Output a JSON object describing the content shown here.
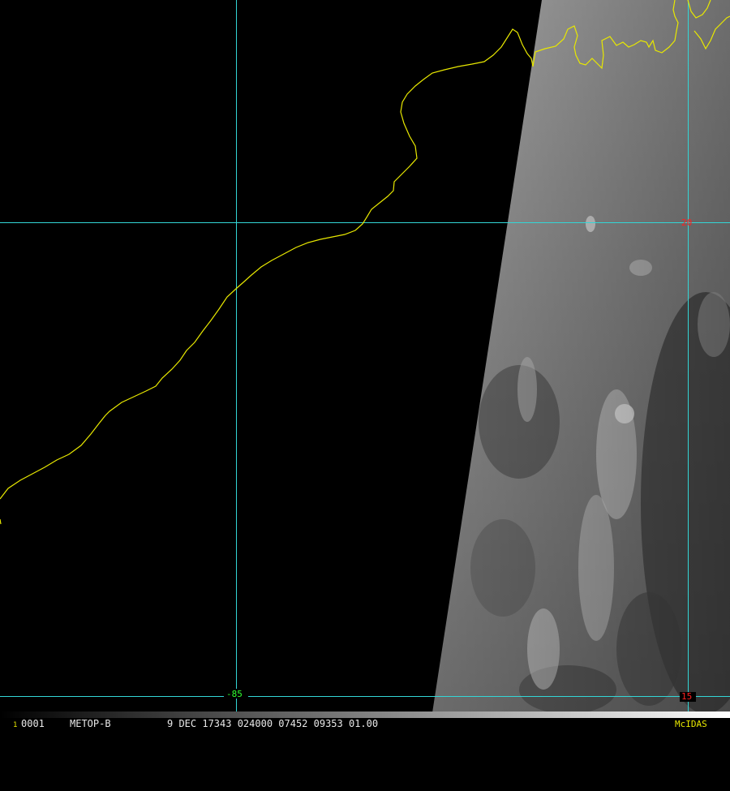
{
  "window": {
    "frame_number": "1",
    "frame_id": "0001",
    "satellite": "METOP-B",
    "datetime_line": "9 DEC 17343 024000 07452 09353 01.00",
    "software": "McIDAS"
  },
  "grid": {
    "lat_labels": [
      "20",
      "15"
    ],
    "lon_labels": [
      "-85"
    ]
  },
  "colors": {
    "background": "#000000",
    "grid": "#33d6d6",
    "coastline": "#e8e800",
    "lat_label": "#ff2020",
    "lon_label": "#30ff30",
    "software_label": "#e8e800"
  }
}
